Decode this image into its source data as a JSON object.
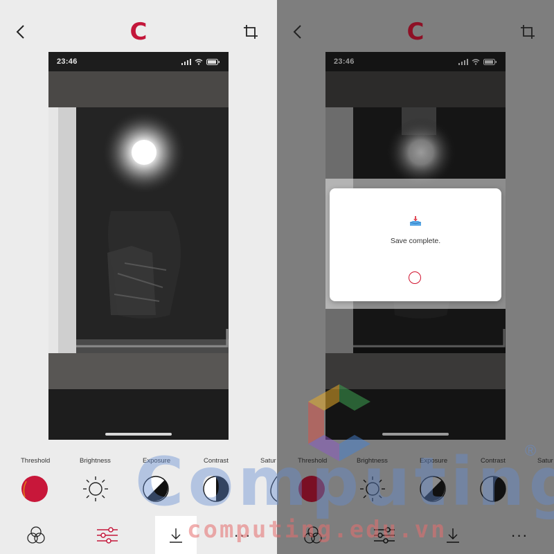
{
  "left_panel": {
    "brand_logo_letter": "C",
    "status_time": "23:46",
    "tools": [
      "Threshold",
      "Brightness",
      "Exposure",
      "Contrast",
      "Satur"
    ],
    "bottom_nav": [
      "filters",
      "adjust",
      "save",
      "more"
    ],
    "more_label": "···"
  },
  "right_panel": {
    "brand_logo_letter": "C",
    "status_time": "23:46",
    "dialog": {
      "message": "Save complete."
    },
    "tools": [
      "Threshold",
      "Brightness",
      "Exposure",
      "Contrast",
      "Satur"
    ],
    "more_label": "···"
  },
  "watermark": {
    "word": "Computing",
    "site": "computing.edu.vn",
    "registered": "®"
  },
  "colors": {
    "brand": "#c3163a",
    "threshold_fill": "#c8173a",
    "panel_bg": "#ececec",
    "dim_bg": "#7e7e7e"
  }
}
